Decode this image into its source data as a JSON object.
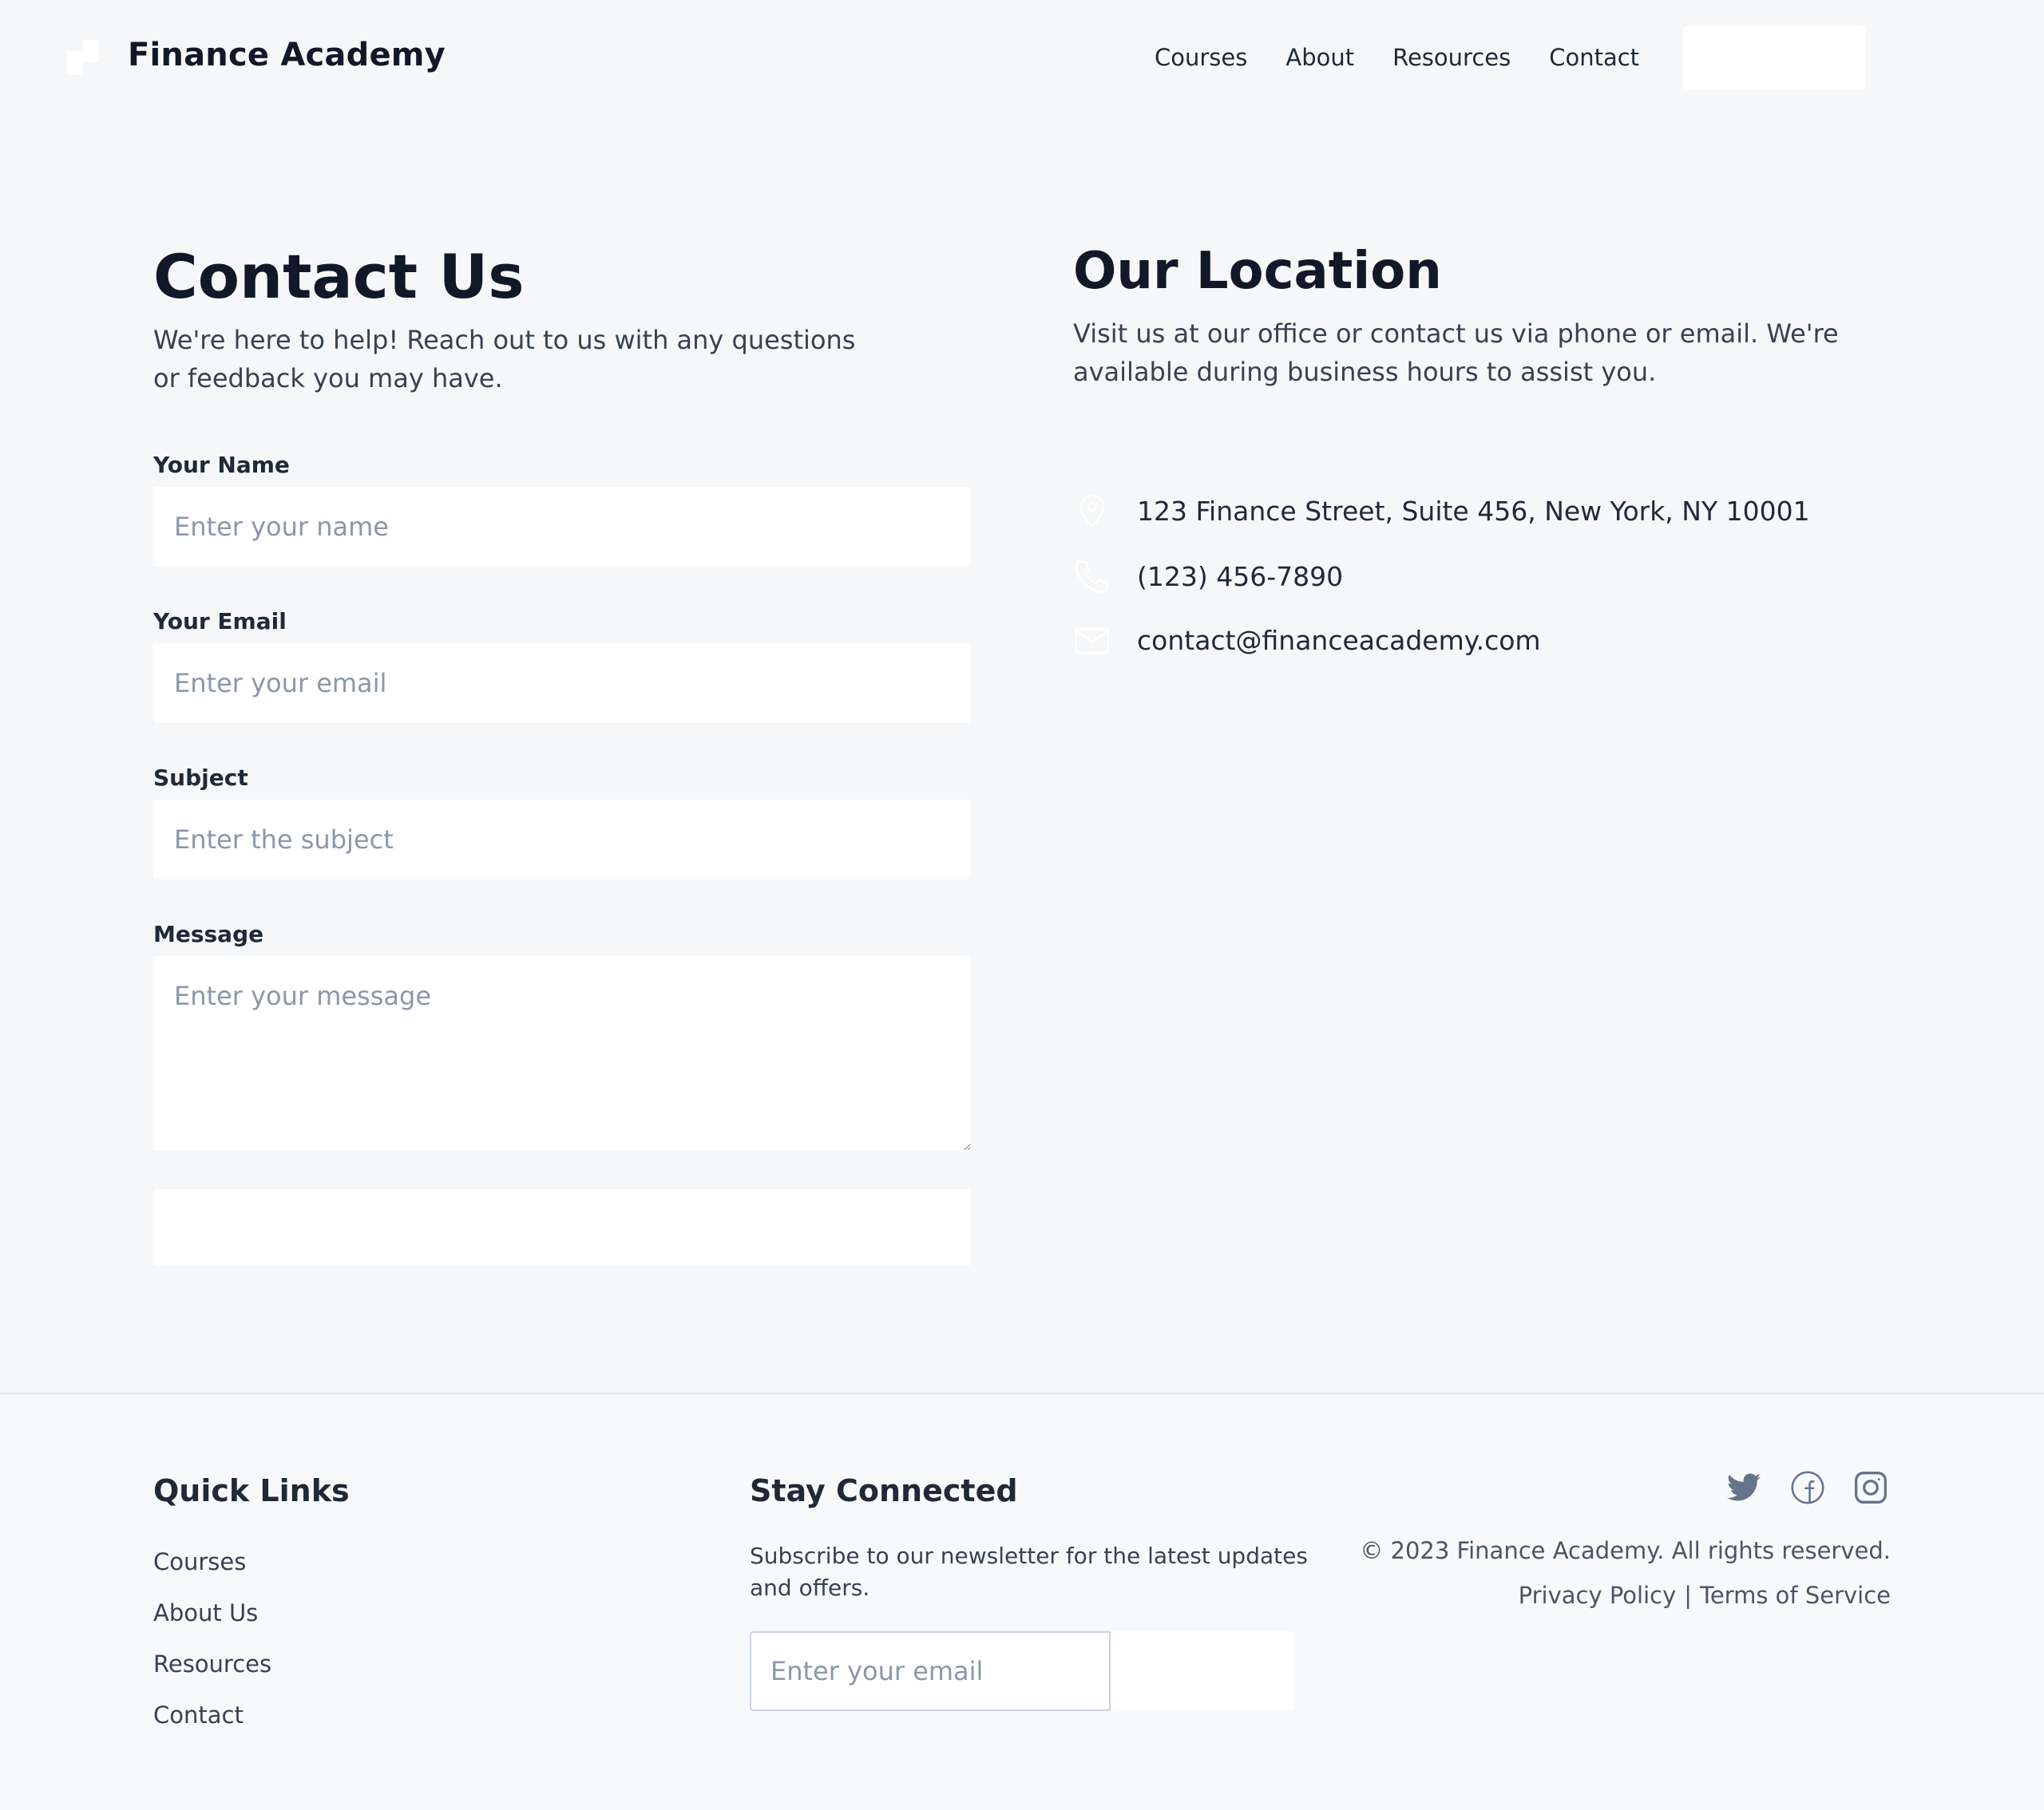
{
  "header": {
    "brand": "Finance Academy",
    "nav": [
      "Courses",
      "About",
      "Resources",
      "Contact"
    ]
  },
  "contact": {
    "title": "Contact Us",
    "lead": "We're here to help! Reach out to us with any questions or feedback you may have.",
    "fields": {
      "name_label": "Your Name",
      "name_placeholder": "Enter your name",
      "email_label": "Your Email",
      "email_placeholder": "Enter your email",
      "subject_label": "Subject",
      "subject_placeholder": "Enter the subject",
      "message_label": "Message",
      "message_placeholder": "Enter your message"
    }
  },
  "location": {
    "title": "Our Location",
    "lead": "Visit us at our office or contact us via phone or email. We're available during business hours to assist you.",
    "address": "123 Finance Street, Suite 456, New York, NY 10001",
    "phone": "(123) 456-7890",
    "email": "contact@financeacademy.com",
    "icons": [
      "map-pin-icon",
      "phone-icon",
      "mail-icon"
    ]
  },
  "footer": {
    "quick_links_title": "Quick Links",
    "quick_links": [
      "Courses",
      "About Us",
      "Resources",
      "Contact"
    ],
    "stay_connected_title": "Stay Connected",
    "stay_connected_text": "Subscribe to our newsletter for the latest updates and offers.",
    "newsletter_placeholder": "Enter your email",
    "social_icons": [
      "twitter-icon",
      "facebook-icon",
      "instagram-icon"
    ],
    "copyright": "© 2023 Finance Academy. All rights reserved.",
    "privacy": "Privacy Policy",
    "separator": "|",
    "terms": "Terms of Service"
  },
  "colors": {
    "background": "#f6f7f8",
    "footer_background": "#f8f9fb",
    "heading": "#111827",
    "body_text": "#374151",
    "placeholder": "#8a97ab",
    "icon_light": "#ffffff",
    "social_icon": "#64748b"
  }
}
